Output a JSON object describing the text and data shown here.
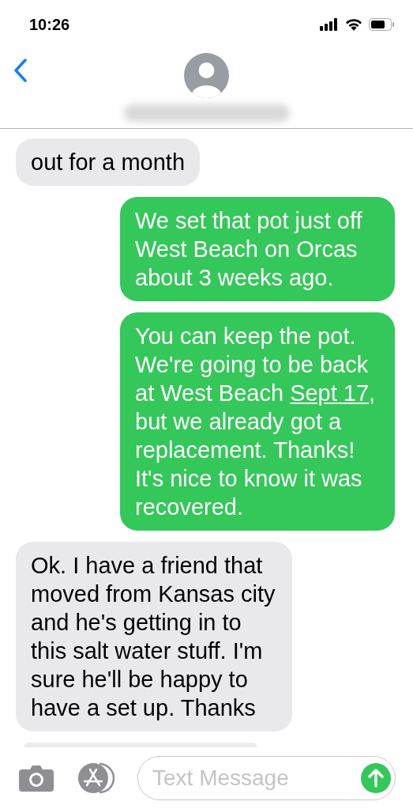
{
  "status_bar": {
    "time": "10:26"
  },
  "messages": [
    {
      "kind": "received",
      "segments": [
        {
          "kind": "plain",
          "text": "out for a month"
        }
      ]
    },
    {
      "kind": "sent",
      "segments": [
        {
          "kind": "plain",
          "text": "We set that pot just off West Beach on Orcas about 3 weeks ago."
        }
      ]
    },
    {
      "kind": "sent",
      "segments": [
        {
          "kind": "plain",
          "text": "You can keep the pot. We're going to be back at West Beach "
        },
        {
          "kind": "link",
          "text": "Sept 17"
        },
        {
          "kind": "plain",
          "text": ", but we already got a replacement. Thanks! It's nice to know it was recovered."
        }
      ]
    },
    {
      "kind": "received",
      "segments": [
        {
          "kind": "plain",
          "text": "Ok. I have a friend that moved from Kansas city and he's getting in to this salt water stuff. I'm sure he'll be happy to have a set up. Thanks"
        }
      ]
    }
  ],
  "composer": {
    "placeholder": "Text Message"
  }
}
